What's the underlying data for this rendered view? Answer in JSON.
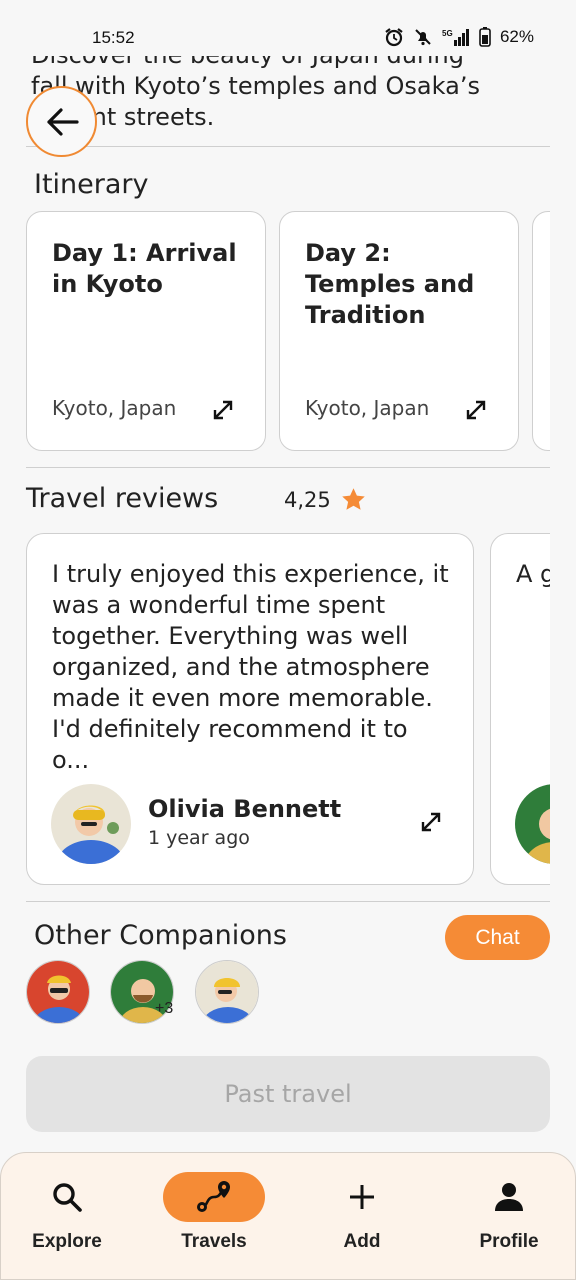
{
  "status_bar": {
    "time": "15:52",
    "battery": "62%",
    "network": "5G"
  },
  "intro": {
    "line1": "Discover the beauty of Japan during",
    "line2": "fall with Kyoto’s temples and Osaka’s",
    "line3": "vibrant streets."
  },
  "itinerary": {
    "title": "Itinerary",
    "days": [
      {
        "title": "Day 1: Arrival in Kyoto",
        "location": "Kyoto, Japan"
      },
      {
        "title": "Day 2: Temples and Tradition",
        "location": "Kyoto, Japan"
      }
    ]
  },
  "reviews": {
    "title": "Travel reviews",
    "rating": "4,25",
    "items": [
      {
        "text": "I truly enjoyed this experience, it was a wonderful time spent together. Everything was well organized, and the atmosphere made it even more memorable. I'd definitely recommend it to o...",
        "author": "Olivia Bennett",
        "time": "1 year ago"
      },
      {
        "text": "A g sig us exp mi tha exp"
      }
    ]
  },
  "companions": {
    "title": "Other Companions",
    "chat_label": "Chat",
    "more_count": "+3"
  },
  "past_travel_label": "Past travel",
  "nav": {
    "items": [
      {
        "label": "Explore",
        "icon": "search-icon"
      },
      {
        "label": "Travels",
        "icon": "route-icon",
        "active": true
      },
      {
        "label": "Add",
        "icon": "plus-icon"
      },
      {
        "label": "Profile",
        "icon": "person-icon"
      }
    ]
  },
  "colors": {
    "accent": "#f58b36",
    "card_border": "#cfcfcf",
    "nav_background": "#fdf3ea",
    "disabled_button": "#e3e3e3"
  }
}
